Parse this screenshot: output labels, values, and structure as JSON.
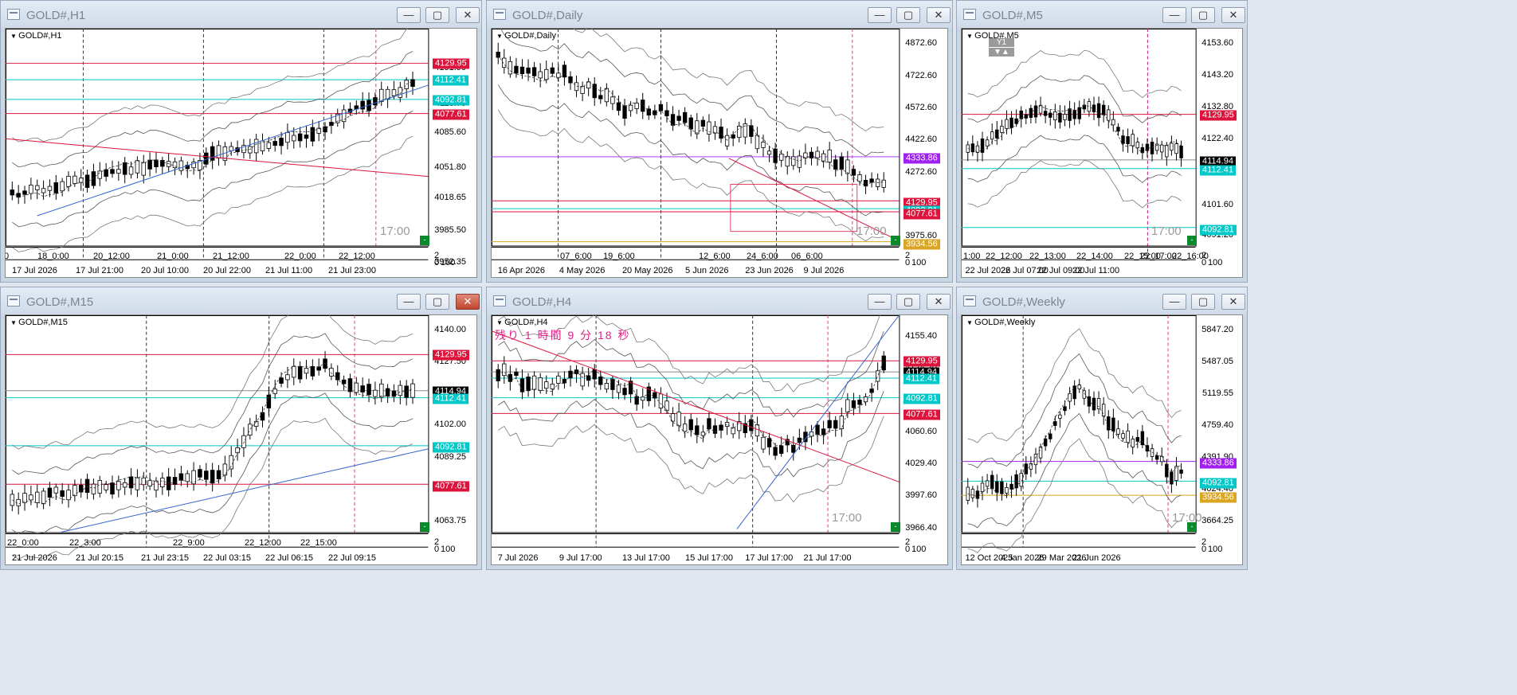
{
  "colors": {
    "red": "#dc143c",
    "cyan": "#00c8c8",
    "purple": "#a020f0",
    "gold": "#daa520",
    "blue": "#3366cc",
    "magenta": "#e0208a"
  },
  "windows": [
    {
      "id": "h1",
      "title": "GOLD#,H1",
      "symbol": "GOLD#,H1",
      "close_highlight": false,
      "price_labels": [
        "4151.90",
        "4118.75",
        "4085.60",
        "4051.80",
        "4018.65",
        "3985.50",
        "3952.35"
      ],
      "badges": [
        {
          "text": "4129.95",
          "color": "red"
        },
        {
          "text": "4112.41",
          "color": "cyan"
        },
        {
          "text": "4092.81",
          "color": "cyan"
        },
        {
          "text": "4077.61",
          "color": "red"
        }
      ],
      "time_labels": [
        "17 Jul 2026",
        "17 Jul 21:00",
        "20 Jul 10:00",
        "20 Jul 22:00",
        "21 Jul 11:00",
        "21 Jul 23:00"
      ],
      "session_labels": [
        "0",
        "18_0:00",
        "20_12:00",
        "21_0:00",
        "21_12:00",
        "22_0:00",
        "22_12:00"
      ],
      "watermark": "17:00",
      "scale_bottom": "0",
      "scale_top": "2",
      "scale_right": "100"
    },
    {
      "id": "daily",
      "title": "GOLD#,Daily",
      "symbol": "GOLD#,Daily",
      "close_highlight": false,
      "price_labels": [
        "4872.60",
        "4722.60",
        "4572.60",
        "4422.60",
        "4272.60",
        "4122.60",
        "3975.60"
      ],
      "badges": [
        {
          "text": "4333.86",
          "color": "purple"
        },
        {
          "text": "4129.95",
          "color": "red"
        },
        {
          "text": "4092.81",
          "color": "cyan"
        },
        {
          "text": "4077.61",
          "color": "red"
        },
        {
          "text": "3934.56",
          "color": "gold"
        }
      ],
      "time_labels": [
        "16 Apr 2026",
        "4 May 2026",
        "20 May 2026",
        "5 Jun 2026",
        "23 Jun 2026",
        "9 Jul 2026"
      ],
      "session_labels": [
        "07_6:00",
        "19_6:00",
        "12_6:00",
        "24_6:00",
        "06_6:00"
      ],
      "watermark": "17:00",
      "scale_bottom": "0",
      "scale_top": "2",
      "scale_right": "100"
    },
    {
      "id": "m5",
      "title": "GOLD#,M5",
      "symbol": "GOLD#,M5",
      "close_highlight": false,
      "price_labels": [
        "4153.60",
        "4143.20",
        "4132.80",
        "4122.40",
        "4101.60",
        "4091.20"
      ],
      "badges": [
        {
          "text": "4129.95",
          "color": "red"
        },
        {
          "text": "4114.94",
          "color": "black"
        },
        {
          "text": "4112.41",
          "color": "cyan"
        },
        {
          "text": "4092.81",
          "color": "cyan"
        }
      ],
      "time_labels": [
        "22 Jul 2026",
        "22 Jul 07:00",
        "22 Jul 09:00",
        "22 Jul 11:00"
      ],
      "session_labels": [
        "1:00",
        "22_12:00",
        "22_13:00",
        "22_14:00",
        "22_15:00",
        "22_16:00",
        "22_17:00"
      ],
      "watermark": "17:00",
      "scale_bottom": "0",
      "scale_top": "2",
      "scale_right": "100",
      "y1": "Y1"
    },
    {
      "id": "m15",
      "title": "GOLD#,M15",
      "symbol": "GOLD#,M15",
      "close_highlight": true,
      "price_labels": [
        "4140.00",
        "4127.50",
        "4102.00",
        "4089.25",
        "4063.75"
      ],
      "badges": [
        {
          "text": "4129.95",
          "color": "red"
        },
        {
          "text": "4114.94",
          "color": "black"
        },
        {
          "text": "4112.41",
          "color": "cyan"
        },
        {
          "text": "4092.81",
          "color": "cyan"
        },
        {
          "text": "4077.61",
          "color": "red"
        }
      ],
      "time_labels": [
        "21 Jul 2026",
        "21 Jul 20:15",
        "21 Jul 23:15",
        "22 Jul 03:15",
        "22 Jul 06:15",
        "22 Jul 09:15"
      ],
      "session_labels": [
        "22_0:00",
        "22_3:00",
        "22_9:00",
        "22_12:00",
        "22_15:00"
      ],
      "watermark": "",
      "scale_bottom": "0",
      "scale_top": "2",
      "scale_right": "100"
    },
    {
      "id": "h4",
      "title": "GOLD#,H4",
      "symbol": "GOLD#,H4",
      "close_highlight": false,
      "countdown": "残り 1 時間 9 分 18 秒",
      "price_labels": [
        "4155.40",
        "4124.20",
        "4060.60",
        "4029.40",
        "3997.60",
        "3966.40"
      ],
      "badges": [
        {
          "text": "4129.95",
          "color": "red"
        },
        {
          "text": "4114.94",
          "color": "black"
        },
        {
          "text": "4112.41",
          "color": "cyan"
        },
        {
          "text": "4092.81",
          "color": "cyan"
        },
        {
          "text": "4077.61",
          "color": "red"
        }
      ],
      "time_labels": [
        "7 Jul 2026",
        "9 Jul 17:00",
        "13 Jul 17:00",
        "15 Jul 17:00",
        "17 Jul 17:00",
        "21 Jul 17:00"
      ],
      "session_labels": [],
      "watermark": "17:00",
      "scale_bottom": "0",
      "scale_top": "2",
      "scale_right": "100"
    },
    {
      "id": "weekly",
      "title": "GOLD#,Weekly",
      "symbol": "GOLD#,Weekly",
      "close_highlight": false,
      "price_labels": [
        "5847.20",
        "5487.05",
        "5119.55",
        "4759.40",
        "4391.90",
        "4024.40",
        "3664.25"
      ],
      "badges": [
        {
          "text": "4333.86",
          "color": "purple"
        },
        {
          "text": "4092.81",
          "color": "cyan"
        },
        {
          "text": "3934.56",
          "color": "gold"
        }
      ],
      "time_labels": [
        "12 Oct 2025",
        "4 Jan 2026",
        "29 Mar 2026",
        "21 Jun 2026"
      ],
      "session_labels": [],
      "watermark": "17:00",
      "scale_bottom": "0",
      "scale_top": "2",
      "scale_right": "100"
    }
  ]
}
